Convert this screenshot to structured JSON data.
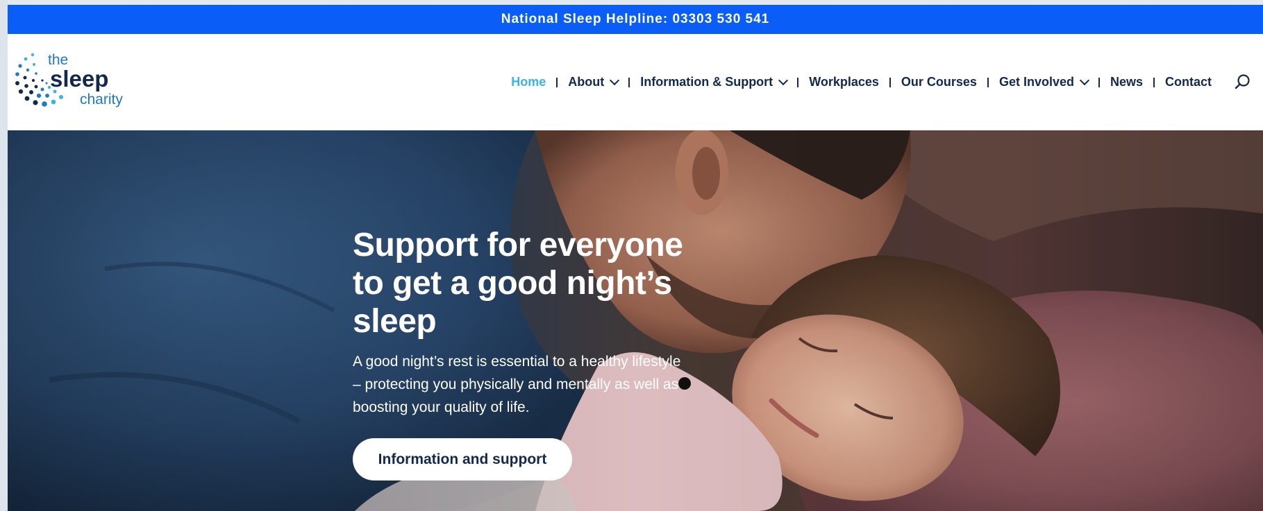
{
  "topbar": {
    "helpline": "National Sleep Helpline: 03303 530 541"
  },
  "logo": {
    "line1": "the",
    "line2": "sleep",
    "line3": "charity",
    "dot_colors": [
      "#12294d",
      "#1e78c2",
      "#3ab3e6"
    ]
  },
  "nav": {
    "items": [
      {
        "label": "Home",
        "active": true,
        "dropdown": false
      },
      {
        "label": "About",
        "active": false,
        "dropdown": true
      },
      {
        "label": "Information & Support",
        "active": false,
        "dropdown": true
      },
      {
        "label": "Workplaces",
        "active": false,
        "dropdown": false
      },
      {
        "label": "Our Courses",
        "active": false,
        "dropdown": false
      },
      {
        "label": "Get Involved",
        "active": false,
        "dropdown": true
      },
      {
        "label": "News",
        "active": false,
        "dropdown": false
      },
      {
        "label": "Contact",
        "active": false,
        "dropdown": false
      }
    ],
    "search_icon": "search-icon"
  },
  "hero": {
    "title_line1": "Support for everyone",
    "title_line2": "to get a good night’s",
    "title_line3": "sleep",
    "subtitle": "A good night’s rest is essential to a healthy lifestyle – protecting you physically and mentally as well as boosting your quality of life.",
    "button_label": "Information and support"
  },
  "colors": {
    "topbar": "#0a5ef7",
    "nav_text": "#12294d",
    "nav_active": "#3ab3e6",
    "button_bg": "#ffffff",
    "button_text": "#12294d"
  }
}
